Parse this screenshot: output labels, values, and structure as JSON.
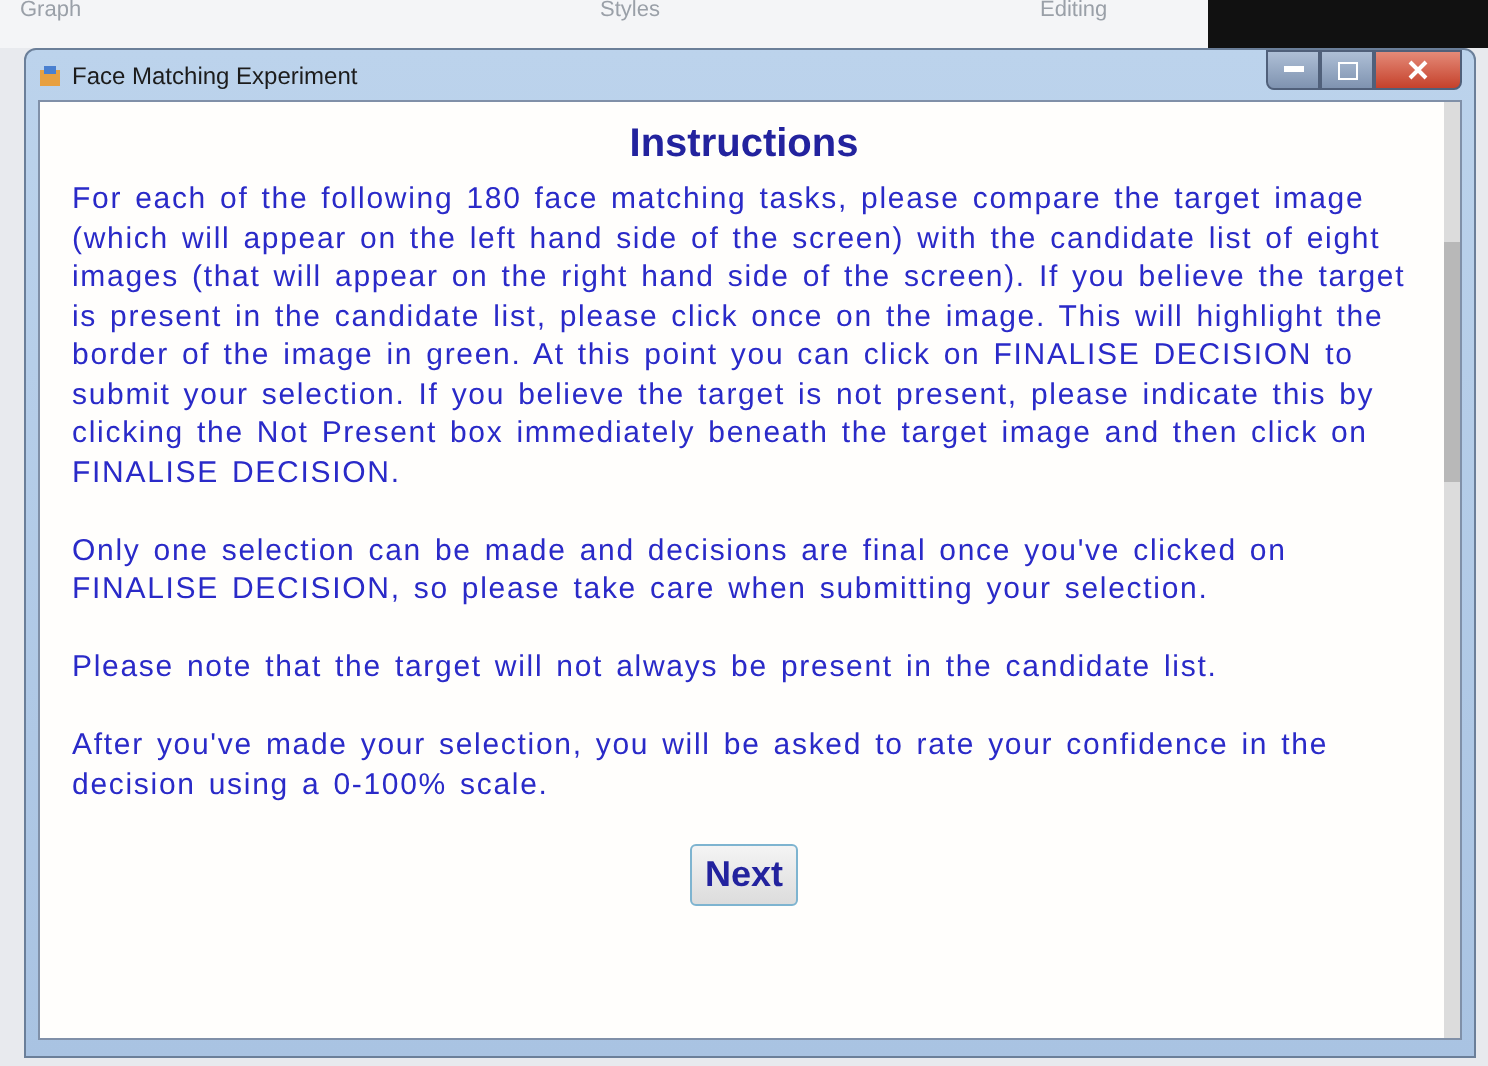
{
  "background_toolbar": {
    "labels": [
      "Graph",
      "Styles",
      "Editing"
    ]
  },
  "window": {
    "title": "Face Matching Experiment"
  },
  "heading": "Instructions",
  "paragraphs": [
    "For each of the following 180 face matching tasks, please compare the target image (which will appear on the left hand side of the screen) with the candidate list of eight images (that will appear on the right hand side of the screen). If you believe the target is present in the candidate list, please click once on the image. This will highlight the border of the image in green. At this point you can click on FINALISE DECISION to submit your selection. If you believe the target is not present, please indicate this by clicking the Not Present box immediately beneath the target image and then click on FINALISE DECISION.",
    "Only one selection can be made and decisions are final once you've clicked on FINALISE DECISION, so please take care when submitting your selection.",
    "Please note that the target will not always be present in the candidate list.",
    "After you've made your selection, you will be asked to rate your confidence in the decision using a 0-100% scale."
  ],
  "button": "Next"
}
